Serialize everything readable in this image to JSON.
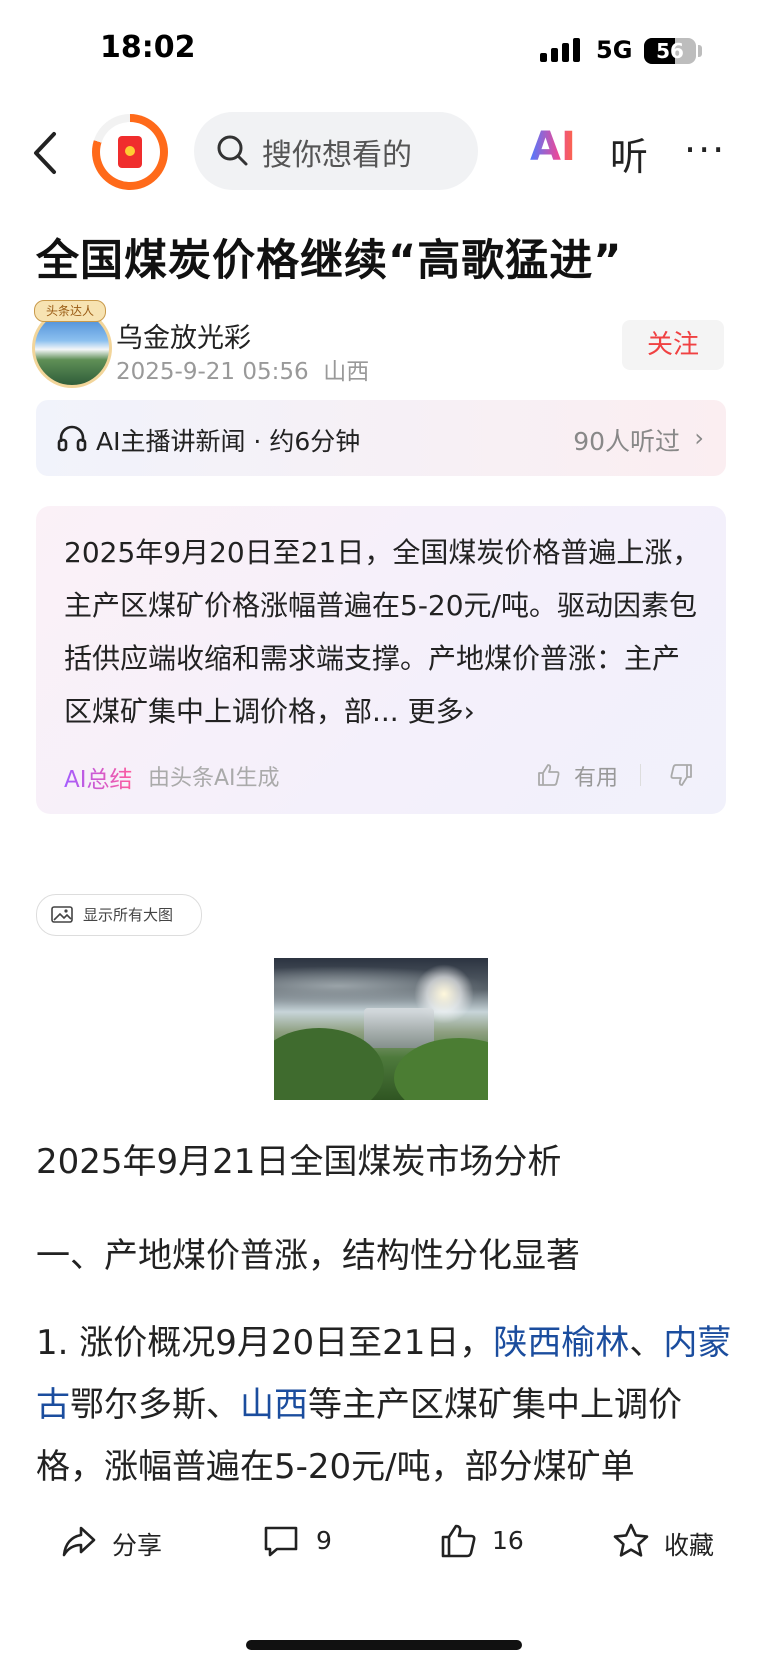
{
  "status_bar": {
    "time": "18:02",
    "network": "5G",
    "battery": "56"
  },
  "nav": {
    "search_placeholder": "搜你想看的",
    "ai_label": "AI",
    "listen_label": "听",
    "more_label": "···"
  },
  "article": {
    "title": "全国煤炭价格继续“高歌猛进”",
    "author": {
      "name": "乌金放光彩",
      "date": "2025-9-21 05:56",
      "location": "山西",
      "badge": "头条达人",
      "follow_label": "关注"
    },
    "listen_bar": {
      "label": "AI主播讲新闻 · 约6分钟",
      "listeners": "90人听过"
    },
    "ai_summary": {
      "text": "2025年9月20日至21日，全国煤炭价格普遍上涨，主产区煤矿价格涨幅普遍在5-20元/吨。驱动因素包括供应端收缩和需求端支撑。产地煤价普涨：主产区煤矿集中上调价格，部...",
      "more_label": "更多",
      "tag": "AI总结",
      "generated_by": "由头条AI生成",
      "useful_label": "有用"
    },
    "show_all_images_label": "显示所有大图",
    "heading1": "2025年9月21日全国煤炭市场分析",
    "heading2": "一、产地煤价普涨，结构性分化显著",
    "paragraph": {
      "prefix": "1. 涨价概况9月20日至21日，",
      "link1": "陕西榆林",
      "sep1": "、",
      "link2": "内蒙古",
      "mid": "鄂尔多斯、",
      "link3": "山西",
      "suffix": "等主产区煤矿集中上调价格，涨幅普遍在5-20元/吨，部分煤矿单"
    }
  },
  "bottom_bar": {
    "share_label": "分享",
    "comments_count": "9",
    "likes_count": "16",
    "favorite_label": "收藏"
  },
  "colors": {
    "follow": "#f04142",
    "link": "#1b4d9e",
    "accent_orange": "#ff6a1a"
  }
}
